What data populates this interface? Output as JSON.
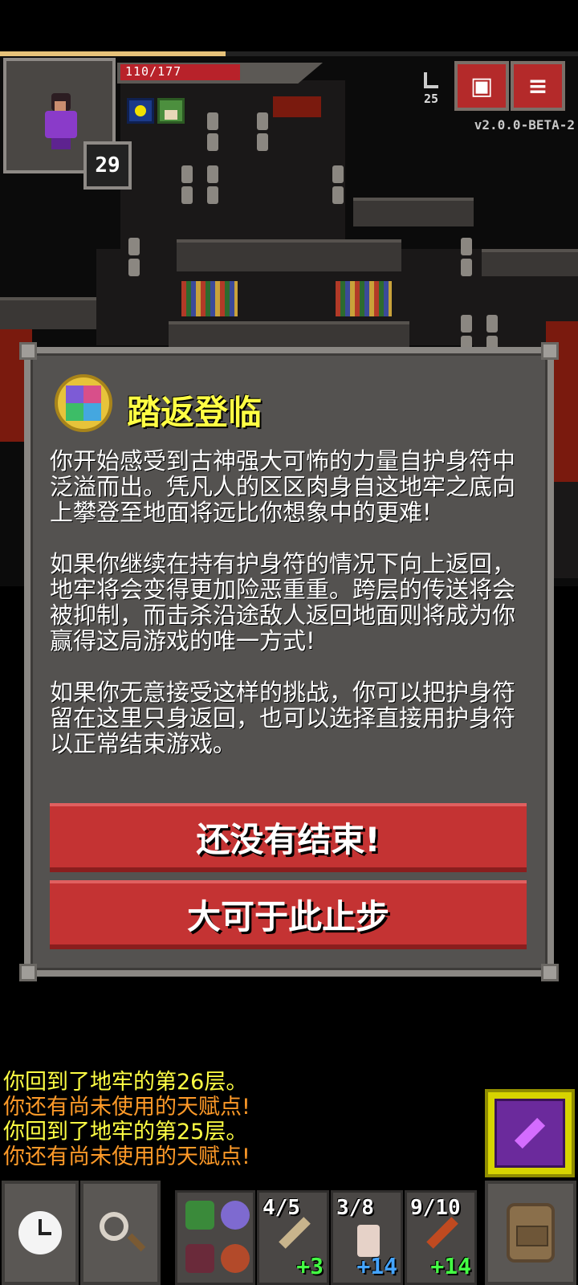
{
  "hud": {
    "hp_text": "110/177",
    "hp_fraction": 0.62,
    "xp_fraction": 0.39,
    "hero_level": "29",
    "depth": "25",
    "version": "v2.0.0-BETA-2",
    "buffs": [
      "bless-buff-icon",
      "herb-buff-icon"
    ],
    "journal_icon": "journal-icon",
    "menu_icon": "menu-icon"
  },
  "dialog": {
    "icon": "amulet-of-yendor-icon",
    "title": "踏返登临",
    "paragraphs": [
      "你开始感受到古神强大可怖的力量自护身符中泛溢而出。凭凡人的区区肉身自这地牢之底向上攀登至地面将远比你想象中的更难!",
      "如果你继续在持有护身符的情况下向上返回，地牢将会变得更加险恶重重。跨层的传送将会被抑制，而击杀沿途敌人返回地面则将成为你赢得这局游戏的唯一方式!",
      "如果你无意接受这样的挑战，你可以把护身符留在这里只身返回，也可以选择直接用护身符以正常结束游戏。"
    ],
    "btn_continue": "还没有结束!",
    "btn_stop": "大可于此止步"
  },
  "log": [
    {
      "text": "你回到了地牢的第26层。",
      "color": "yellow"
    },
    {
      "text": "你还有尚未使用的天赋点!",
      "color": "orange"
    },
    {
      "text": "你回到了地牢的第25层。",
      "color": "yellow"
    },
    {
      "text": "你还有尚未使用的天赋点!",
      "color": "orange"
    }
  ],
  "toolbar": {
    "wait_icon": "clock-icon",
    "search_icon": "magnifier-icon",
    "backpack_icon": "backpack-icon",
    "spell_icon": "spell-icon",
    "quickslots": [
      {
        "charges": "4/5",
        "bonus": "+3",
        "bonus_color": "green",
        "icon": "wand-icon"
      },
      {
        "charges": "3/8",
        "bonus": "+14",
        "bonus_color": "blue",
        "icon": "armor-icon"
      },
      {
        "charges": "9/10",
        "bonus": "+14",
        "bonus_color": "green",
        "icon": "wand-icon"
      }
    ]
  }
}
